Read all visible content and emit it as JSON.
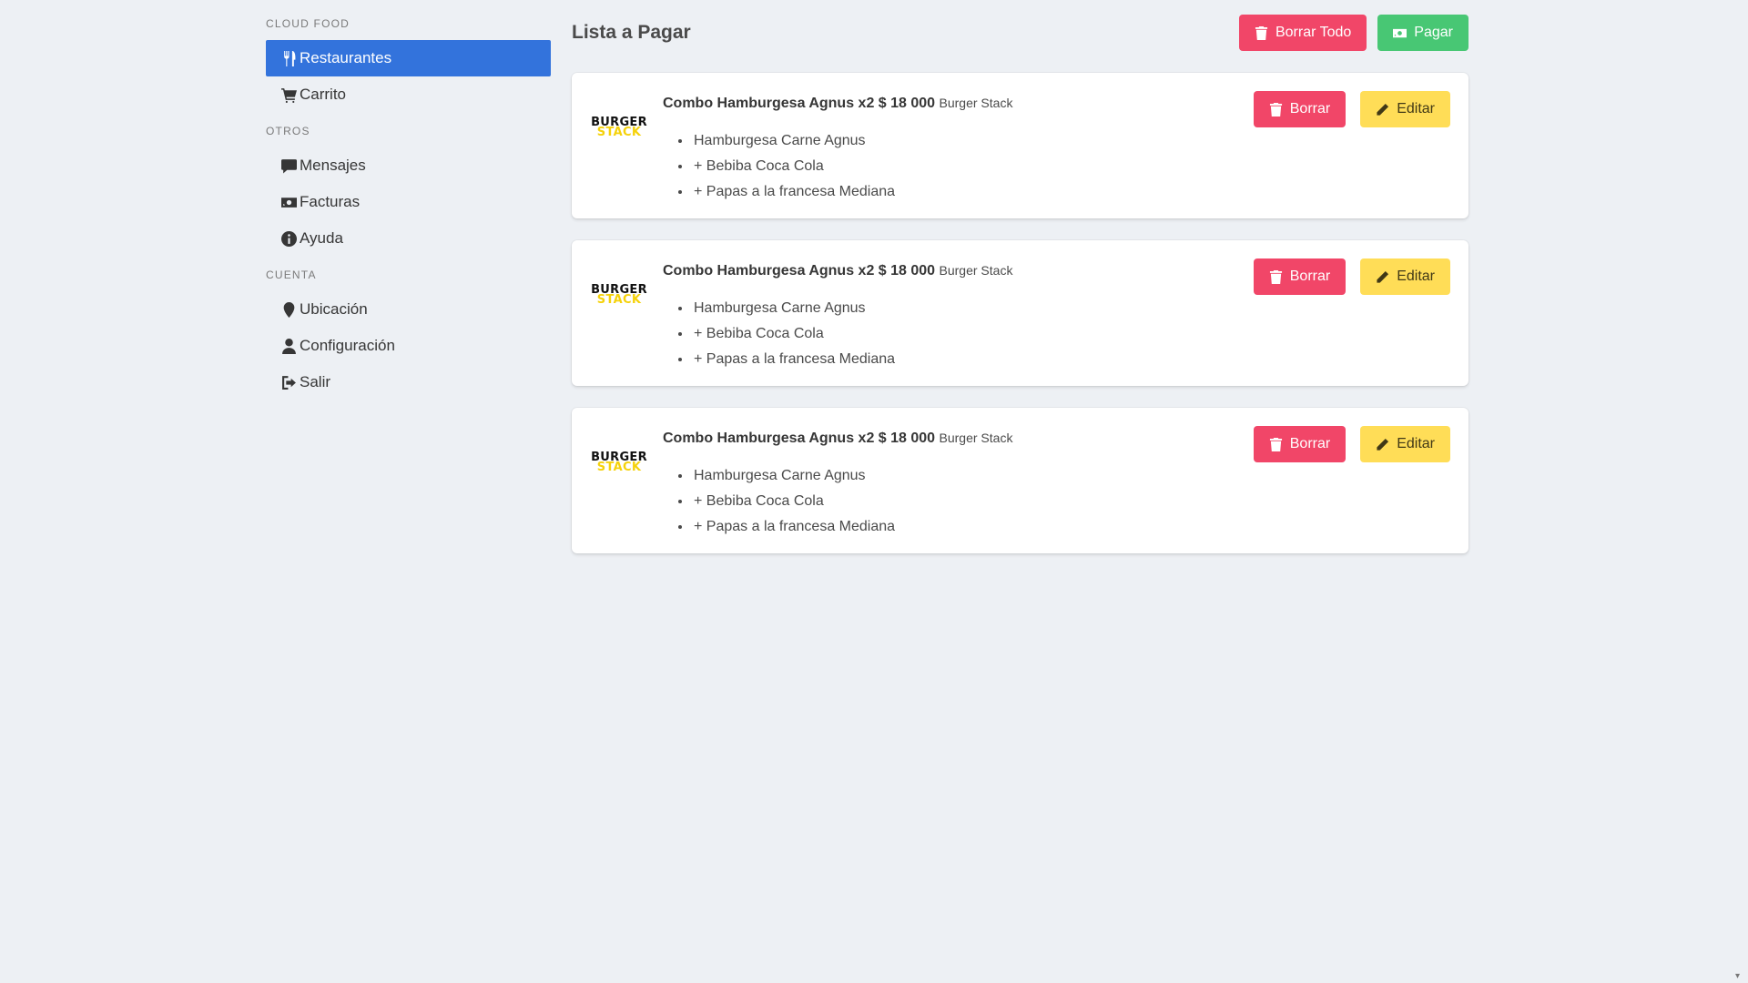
{
  "sidebar": {
    "sections": [
      {
        "label": "Cloud Food",
        "items": [
          {
            "label": "Restaurantes",
            "icon": "utensils-icon",
            "active": true
          },
          {
            "label": "Carrito",
            "icon": "cart-icon",
            "active": false
          }
        ]
      },
      {
        "label": "Otros",
        "items": [
          {
            "label": "Mensajes",
            "icon": "message-icon",
            "active": false
          },
          {
            "label": "Facturas",
            "icon": "money-bill-icon",
            "active": false
          },
          {
            "label": "Ayuda",
            "icon": "info-icon",
            "active": false
          }
        ]
      },
      {
        "label": "Cuenta",
        "items": [
          {
            "label": "Ubicación",
            "icon": "map-marker-icon",
            "active": false
          },
          {
            "label": "Configuración",
            "icon": "user-icon",
            "active": false
          },
          {
            "label": "Salir",
            "icon": "sign-out-icon",
            "active": false
          }
        ]
      }
    ]
  },
  "header": {
    "title": "Lista a Pagar",
    "delete_all_label": "Borrar Todo",
    "pay_label": "Pagar"
  },
  "colors": {
    "active": "#3373dc",
    "danger": "#f14668",
    "success": "#48c774",
    "warning": "#ffdd57",
    "background": "#edf0f4"
  },
  "orders": [
    {
      "logo_line1": "BURGER",
      "logo_line2": "STACK",
      "title": "Combo Hamburgesa Agnus x2 $ 18 000",
      "restaurant": "Burger Stack",
      "items": [
        "Hamburgesa Carne Agnus",
        "+ Bebiba Coca Cola",
        "+ Papas a la francesa Mediana"
      ],
      "delete_label": "Borrar",
      "edit_label": "Editar"
    },
    {
      "logo_line1": "BURGER",
      "logo_line2": "STACK",
      "title": "Combo Hamburgesa Agnus x2 $ 18 000",
      "restaurant": "Burger Stack",
      "items": [
        "Hamburgesa Carne Agnus",
        "+ Bebiba Coca Cola",
        "+ Papas a la francesa Mediana"
      ],
      "delete_label": "Borrar",
      "edit_label": "Editar"
    },
    {
      "logo_line1": "BURGER",
      "logo_line2": "STACK",
      "title": "Combo Hamburgesa Agnus x2 $ 18 000",
      "restaurant": "Burger Stack",
      "items": [
        "Hamburgesa Carne Agnus",
        "+ Bebiba Coca Cola",
        "+ Papas a la francesa Mediana"
      ],
      "delete_label": "Borrar",
      "edit_label": "Editar"
    }
  ]
}
